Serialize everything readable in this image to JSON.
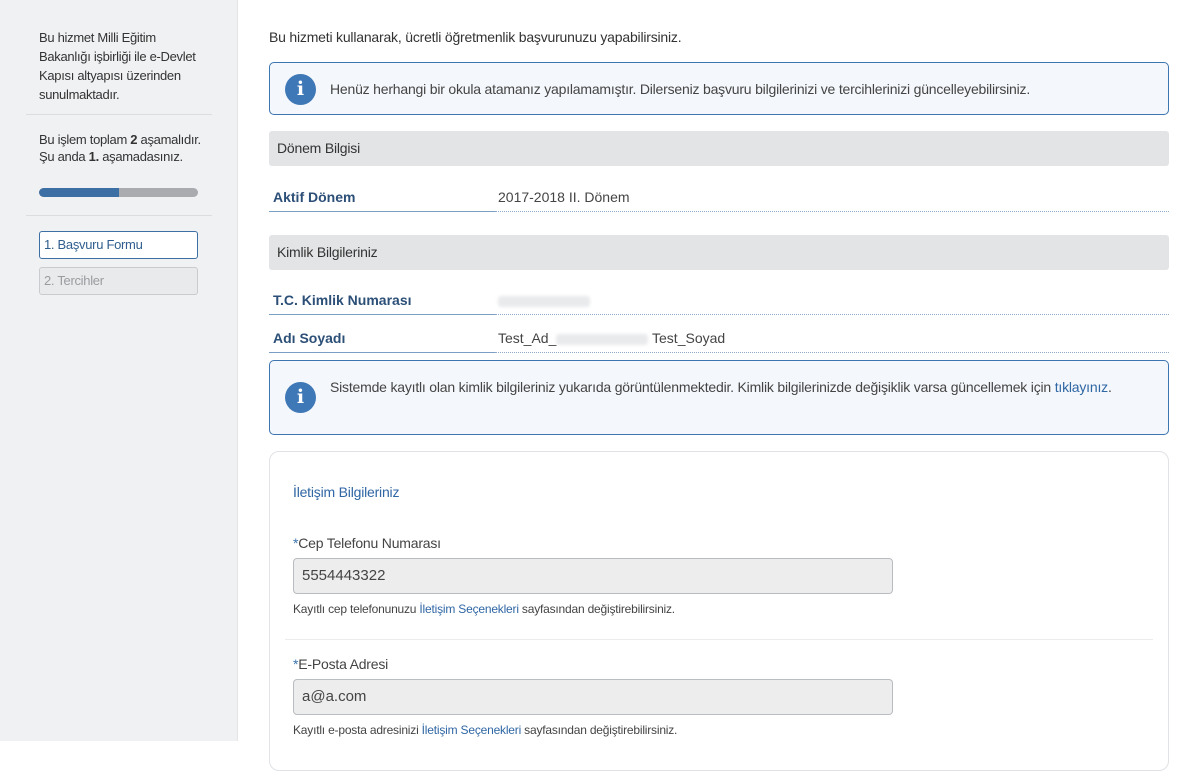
{
  "sidebar": {
    "info": "Bu hizmet Milli Eğitim Bakanlığı işbirliği ile e-Devlet Kapısı altyapısı üzerinden sunulmaktadır.",
    "step_line1_pre": "Bu işlem toplam ",
    "step_total": "2",
    "step_line1_post": " aşamalıdır.",
    "step_line2_pre": "Şu anda ",
    "step_current": "1.",
    "step_line2_post": " aşamadasınız.",
    "progress_fraction": 0.5,
    "nav": [
      {
        "label": "1. Başvuru Formu",
        "state": "active"
      },
      {
        "label": "2. Tercihler",
        "state": "disabled"
      }
    ]
  },
  "main": {
    "intro": "Bu hizmeti kullanarak, ücretli öğretmenlik başvurunuzu yapabilirsiniz.",
    "alert1": "Henüz herhangi bir okula atamanız yapılamamıştır. Dilerseniz başvuru bilgilerinizi ve tercihlerinizi güncelleyebilirsiniz.",
    "period_section": "Dönem Bilgisi",
    "period_label": "Aktif Dönem",
    "period_value": "2017-2018 II. Dönem",
    "identity_section": "Kimlik Bilgileriniz",
    "tc_label": "T.C. Kimlik Numarası",
    "name_label": "Adı Soyadı",
    "name_value_pre": "Test_Ad_",
    "name_value_post": "Test_Soyad",
    "alert2_text": "Sistemde kayıtlı olan kimlik bilgileriniz yukarıda görüntülenmektedir. Kimlik bilgilerinizde değişiklik varsa güncellemek için ",
    "alert2_link": "tıklayınız",
    "alert2_end": "."
  },
  "contact": {
    "title": "İletişim Bilgileriniz",
    "required_mark": "*",
    "phone_label": "Cep Telefonu Numarası",
    "phone_value": "5554443322",
    "phone_help_pre": "Kayıtlı cep telefonunuzu ",
    "phone_help_link": "İletişim Seçenekleri",
    "phone_help_post": " sayfasından değiştirebilirsiniz.",
    "email_label": "E-Posta Adresi",
    "email_value": "a@a.com",
    "email_help_pre": "Kayıtlı e-posta adresinizi ",
    "email_help_link": "İletişim Seçenekleri",
    "email_help_post": " sayfasından değiştirebilirsiniz."
  },
  "colors": {
    "accent": "#3c6fa3",
    "info_icon": "#3f78b6",
    "label_text": "#2c4f77"
  },
  "icons": {
    "info": "info-circle-icon"
  }
}
